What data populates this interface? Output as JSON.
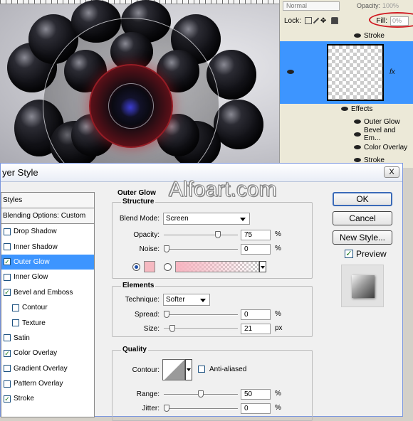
{
  "layers_panel": {
    "blend_mode": "Normal",
    "opacity_label": "Opacity:",
    "opacity_value": "100%",
    "lock_label": "Lock:",
    "fill_label": "Fill:",
    "fill_value": "0%",
    "layers": [
      {
        "label": "Stroke"
      },
      {
        "label": "Effects"
      },
      {
        "label": "Outer Glow"
      },
      {
        "label": "Bevel and Em..."
      },
      {
        "label": "Color Overlay"
      },
      {
        "label": "Stroke"
      }
    ],
    "fx_label": "fx",
    "highlight_color": "#3d95ff",
    "fill_oval_color": "#d01820"
  },
  "dialog": {
    "title": "yer Style",
    "close_label": "X",
    "watermark": "Alfoart.com",
    "styles_header": "Styles",
    "blending_options": "Blending Options: Custom",
    "styles": [
      {
        "label": "Drop Shadow",
        "checked": false,
        "indent": false,
        "selected": false
      },
      {
        "label": "Inner Shadow",
        "checked": false,
        "indent": false,
        "selected": false
      },
      {
        "label": "Outer Glow",
        "checked": true,
        "indent": false,
        "selected": true
      },
      {
        "label": "Inner Glow",
        "checked": false,
        "indent": false,
        "selected": false
      },
      {
        "label": "Bevel and Emboss",
        "checked": true,
        "indent": false,
        "selected": false
      },
      {
        "label": "Contour",
        "checked": false,
        "indent": true,
        "selected": false
      },
      {
        "label": "Texture",
        "checked": false,
        "indent": true,
        "selected": false
      },
      {
        "label": "Satin",
        "checked": false,
        "indent": false,
        "selected": false
      },
      {
        "label": "Color Overlay",
        "checked": true,
        "indent": false,
        "selected": false
      },
      {
        "label": "Gradient Overlay",
        "checked": false,
        "indent": false,
        "selected": false
      },
      {
        "label": "Pattern Overlay",
        "checked": false,
        "indent": false,
        "selected": false
      },
      {
        "label": "Stroke",
        "checked": true,
        "indent": false,
        "selected": false
      }
    ],
    "section_title": "Outer Glow",
    "structure": {
      "title": "Structure",
      "blend_mode_label": "Blend Mode:",
      "blend_mode_value": "Screen",
      "opacity_label": "Opacity:",
      "opacity_value": "75",
      "opacity_unit": "%",
      "opacity_level": 0.75,
      "noise_label": "Noise:",
      "noise_value": "0",
      "noise_unit": "%",
      "noise_level": 0,
      "glow_color": "#f6b9c1"
    },
    "elements": {
      "title": "Elements",
      "technique_label": "Technique:",
      "technique_value": "Softer",
      "spread_label": "Spread:",
      "spread_value": "0",
      "spread_unit": "%",
      "spread_level": 0,
      "size_label": "Size:",
      "size_value": "21",
      "size_unit": "px",
      "size_level": 0.085
    },
    "quality": {
      "title": "Quality",
      "contour_label": "Contour:",
      "antialiased_label": "Anti-aliased",
      "range_label": "Range:",
      "range_value": "50",
      "range_unit": "%",
      "range_level": 0.5,
      "jitter_label": "Jitter:",
      "jitter_value": "0",
      "jitter_unit": "%",
      "jitter_level": 0
    },
    "buttons": {
      "ok": "OK",
      "cancel": "Cancel",
      "new_style": "New Style...",
      "preview_label": "Preview",
      "preview_checked": true
    }
  }
}
